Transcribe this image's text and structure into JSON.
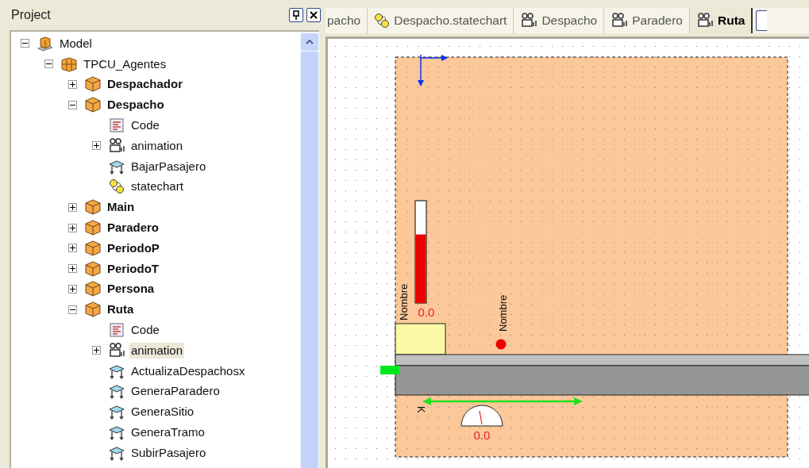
{
  "project_panel": {
    "title": "Project"
  },
  "tree": [
    {
      "label": "Model",
      "kind": "model",
      "expanded": true,
      "selected": false,
      "children": [
        {
          "label": "TPCU_Agentes",
          "kind": "package",
          "expanded": true,
          "selected": false,
          "children": [
            {
              "label": "Despachador",
              "kind": "agent",
              "expanded": false,
              "selected": false
            },
            {
              "label": "Despacho",
              "kind": "agent",
              "expanded": true,
              "selected": false,
              "children": [
                {
                  "label": "Code",
                  "kind": "code",
                  "selected": false
                },
                {
                  "label": "animation",
                  "kind": "animation",
                  "expanded": false,
                  "selected": false
                },
                {
                  "label": "BajarPasajero",
                  "kind": "function",
                  "selected": false
                },
                {
                  "label": "statechart",
                  "kind": "statechart",
                  "selected": false
                }
              ]
            },
            {
              "label": "Main",
              "kind": "agent",
              "expanded": false,
              "selected": false
            },
            {
              "label": "Paradero",
              "kind": "agent",
              "expanded": false,
              "selected": false
            },
            {
              "label": "PeriodoP",
              "kind": "agent",
              "expanded": false,
              "selected": false
            },
            {
              "label": "PeriodoT",
              "kind": "agent",
              "expanded": false,
              "selected": false
            },
            {
              "label": "Persona",
              "kind": "agent",
              "expanded": false,
              "selected": false
            },
            {
              "label": "Ruta",
              "kind": "agent",
              "expanded": true,
              "selected": false,
              "children": [
                {
                  "label": "Code",
                  "kind": "code",
                  "selected": false
                },
                {
                  "label": "animation",
                  "kind": "animation",
                  "expanded": false,
                  "selected": true
                },
                {
                  "label": "ActualizaDespachosx",
                  "kind": "function",
                  "selected": false
                },
                {
                  "label": "GeneraParadero",
                  "kind": "function",
                  "selected": false
                },
                {
                  "label": "GeneraSitio",
                  "kind": "function",
                  "selected": false
                },
                {
                  "label": "GeneraTramo",
                  "kind": "function",
                  "selected": false
                },
                {
                  "label": "SubirPasajero",
                  "kind": "function",
                  "selected": false
                }
              ]
            }
          ]
        }
      ]
    }
  ],
  "tabs": [
    {
      "label": "pacho",
      "kind": "plain",
      "selected": false
    },
    {
      "label": "Despacho.statechart",
      "kind": "statechart",
      "selected": false
    },
    {
      "label": "Despacho",
      "kind": "animation",
      "selected": false
    },
    {
      "label": "Paradero",
      "kind": "animation",
      "selected": false
    },
    {
      "label": "Ruta",
      "kind": "animation",
      "selected": true
    }
  ],
  "canvas": {
    "thermometer": {
      "level": 0.67,
      "reading": "0.0"
    },
    "labels": [
      {
        "text": "Nombre"
      },
      {
        "text": "Nombre"
      }
    ],
    "arrow_label": "K",
    "gauge": {
      "reading": "0.0"
    }
  }
}
